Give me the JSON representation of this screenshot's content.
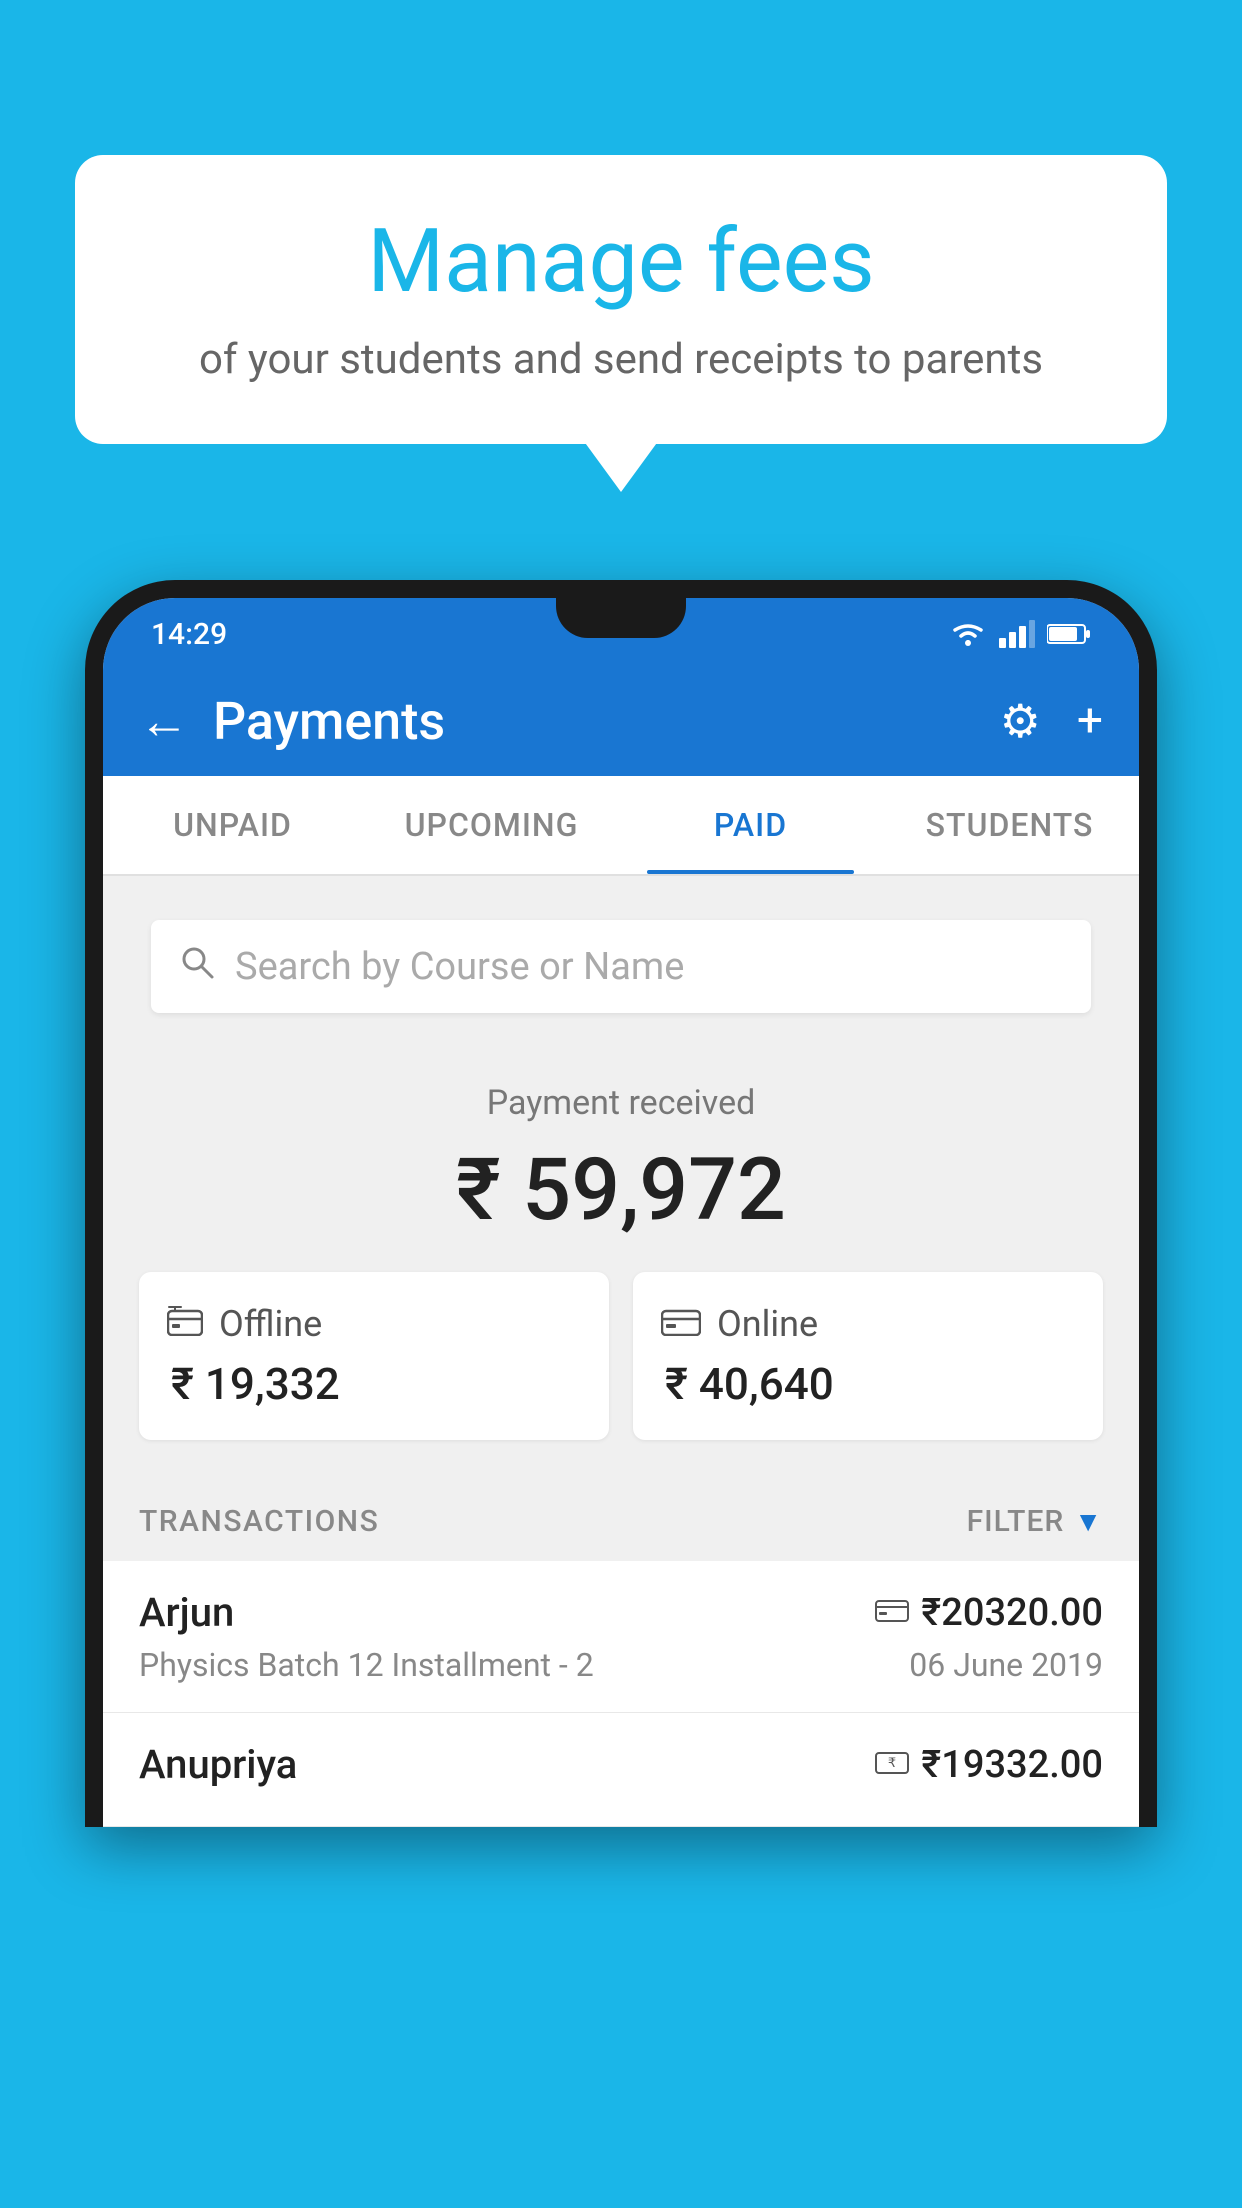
{
  "page": {
    "background_color": "#1ab6e8"
  },
  "speech_bubble": {
    "title": "Manage fees",
    "subtitle": "of your students and send receipts to parents"
  },
  "status_bar": {
    "time": "14:29"
  },
  "app_bar": {
    "title": "Payments",
    "back_icon": "←",
    "settings_icon": "⚙",
    "add_icon": "+"
  },
  "tabs": [
    {
      "label": "UNPAID",
      "active": false
    },
    {
      "label": "UPCOMING",
      "active": false
    },
    {
      "label": "PAID",
      "active": true
    },
    {
      "label": "STUDENTS",
      "active": false
    }
  ],
  "search": {
    "placeholder": "Search by Course or Name"
  },
  "payment_summary": {
    "label": "Payment received",
    "total": "₹ 59,972",
    "offline_label": "Offline",
    "offline_amount": "₹ 19,332",
    "online_label": "Online",
    "online_amount": "₹ 40,640"
  },
  "transactions": {
    "section_label": "TRANSACTIONS",
    "filter_label": "FILTER",
    "rows": [
      {
        "name": "Arjun",
        "course": "Physics Batch 12 Installment - 2",
        "amount": "₹20320.00",
        "date": "06 June 2019",
        "payment_mode": "card"
      },
      {
        "name": "Anupriya",
        "course": "",
        "amount": "₹19332.00",
        "date": "",
        "payment_mode": "cash"
      }
    ]
  }
}
